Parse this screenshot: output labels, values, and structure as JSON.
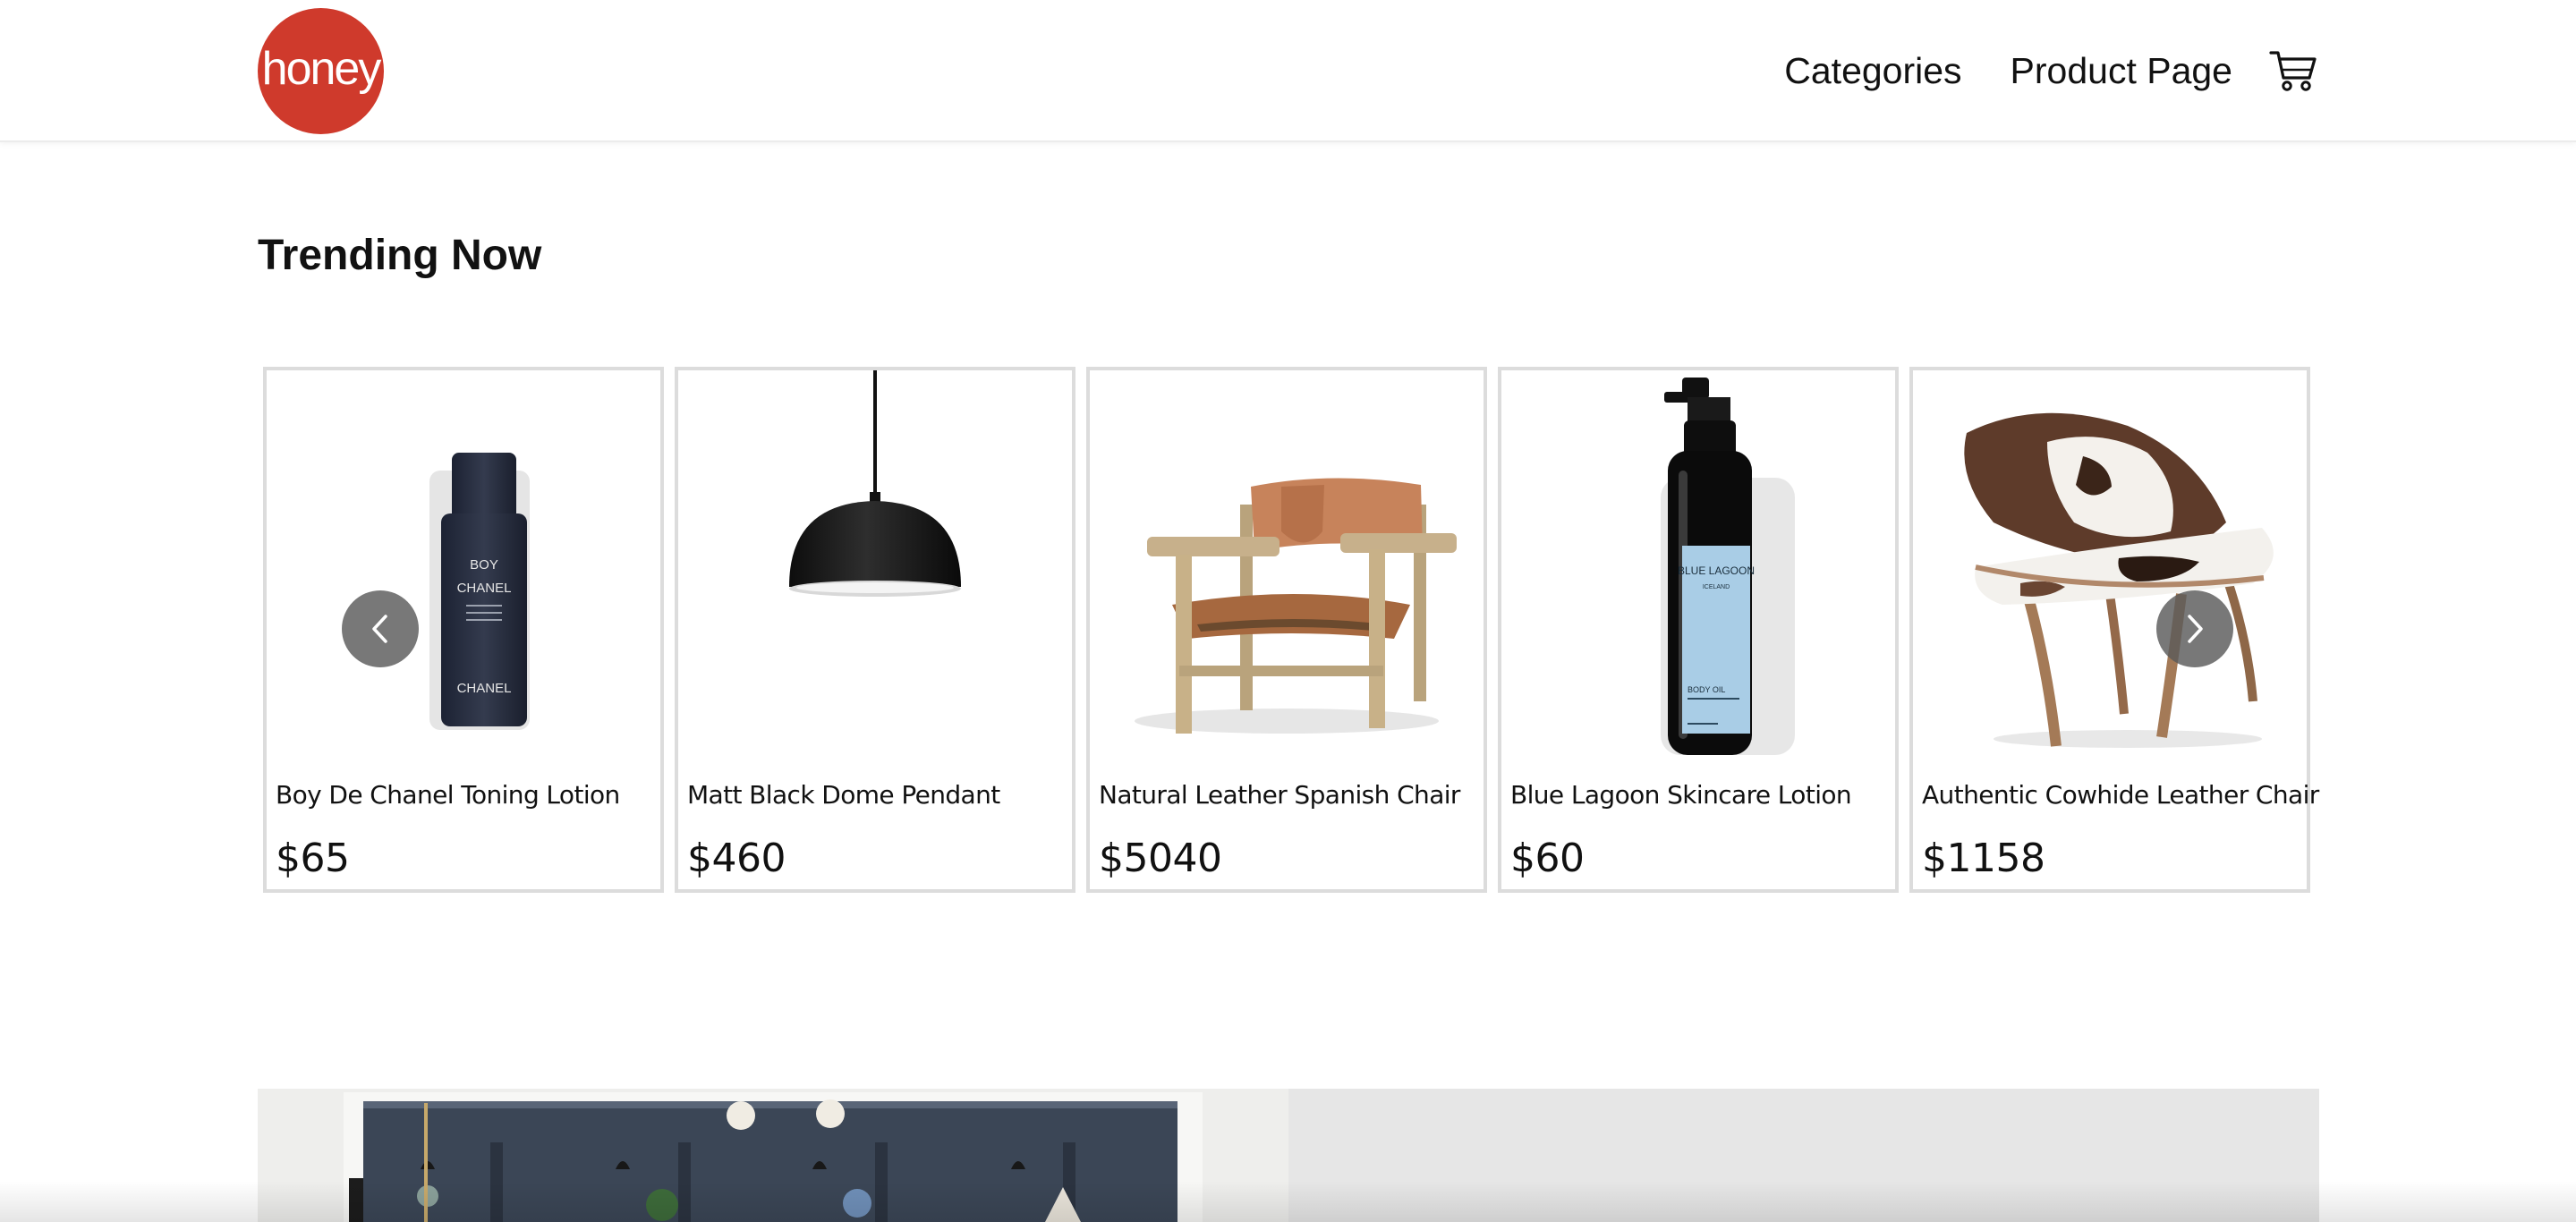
{
  "brand": {
    "logo_text": "honey",
    "logo_color": "#cf3a2c"
  },
  "nav": {
    "items": [
      {
        "label": "Categories"
      },
      {
        "label": "Product Page"
      }
    ],
    "cart_icon": "shopping-cart-icon"
  },
  "trending": {
    "title": "Trending Now",
    "prev_icon": "chevron-left-icon",
    "next_icon": "chevron-right-icon",
    "products": [
      {
        "name": "Boy De Chanel Toning Lotion",
        "price": "$65"
      },
      {
        "name": "Matt Black Dome Pendant",
        "price": "$460"
      },
      {
        "name": "Natural Leather Spanish Chair",
        "price": "$5040"
      },
      {
        "name": "Blue Lagoon Skincare Lotion",
        "price": "$60"
      },
      {
        "name": "Authentic Cowhide Leather Chair",
        "price": "$1158"
      }
    ],
    "chanel_bottle_text": [
      "BOY",
      "CHANEL",
      "CHANEL"
    ],
    "blue_lagoon_text": [
      "BLUE LAGOON",
      "ICELAND",
      "BODY OIL"
    ]
  },
  "colors": {
    "card_border": "#dcdcdc",
    "arrow_bg": "#5a5a5a",
    "banner_bg": "#e6e6e6"
  }
}
